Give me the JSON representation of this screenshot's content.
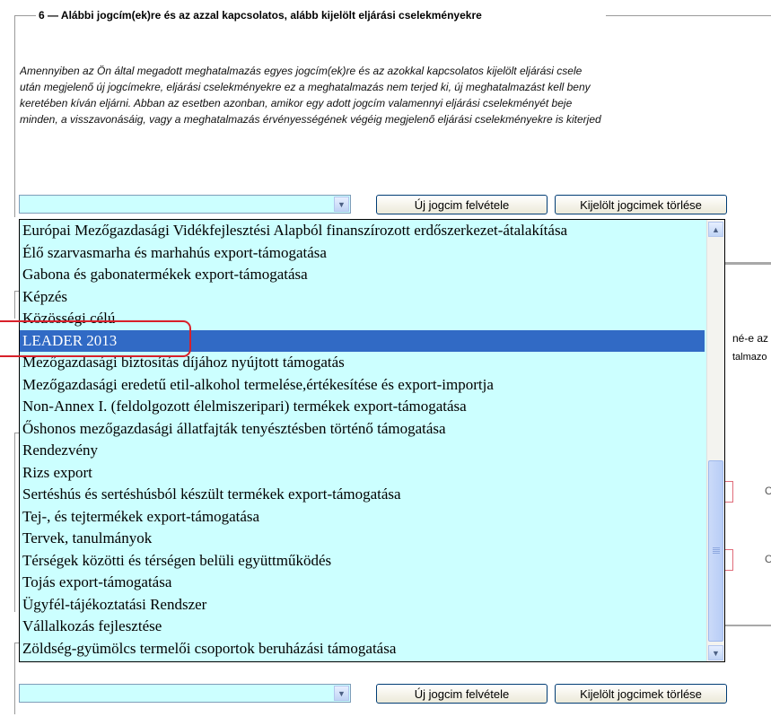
{
  "section": {
    "legend": "6 — Alábbi jogcím(ek)re és az azzal kapcsolatos, alább kijelölt eljárási cselekményekre",
    "paragraph_lines": [
      "Amennyiben az Ön által megadott meghatalmazás egyes jogcím(ek)re és az azokkal kapcsolatos kijelölt eljárási csele",
      "után megjelenő új jogcímekre, eljárási cselekményekre ez a meghatalmazás nem terjed ki, új meghatalmazást kell beny",
      "keretében kíván eljárni. Abban az esetben azonban, amikor egy adott jogcím valamennyi eljárási cselekményét beje",
      "minden, a visszavonásáig, vagy a meghatalmazás érvényességének végéig megjelenő eljárási cselekményekre is kiterjed"
    ]
  },
  "controls": {
    "add_button": "Új jogcim felvétele",
    "delete_button": "Kijelölt jogcimek törlése",
    "combo_value": ""
  },
  "dropdown": {
    "selected_index": 5,
    "options": [
      "Európai Mezőgazdasági Vidékfejlesztési Alapból finanszírozott erdőszerkezet-átalakítása",
      "Élő szarvasmarha és marhahús export-támogatása",
      "Gabona és gabonatermékek export-támogatása",
      "Képzés",
      "Közösségi célú",
      "LEADER 2013",
      "Mezőgazdasági biztosítás díjához nyújtott támogatás",
      "Mezőgazdasági eredetű etil-alkohol termelése,értékesítése és export-importja",
      "Non-Annex I. (feldolgozott élelmiszeripari) termékek export-támogatása",
      "Őshonos mezőgazdasági állatfajták tenyésztésben történő támogatása",
      "Rendezvény",
      "Rizs export",
      "Sertéshús és sertéshúsból készült termékek export-támogatása",
      "Tej-, és tejtermékek export-támogatása",
      "Tervek, tanulmányok",
      "Térségek közötti és térségen belüli együttműködés",
      "Tojás export-támogatása",
      "Ügyfél-tájékoztatási Rendszer",
      "Vállalkozás fejlesztése",
      "Zöldség-gyümölcs termelői csoportok beruházási támogatása"
    ]
  },
  "background_text": {
    "right_line1": "né-e az",
    "right_line2": "talmazo",
    "right_c1": "C",
    "right_c2": "C"
  }
}
